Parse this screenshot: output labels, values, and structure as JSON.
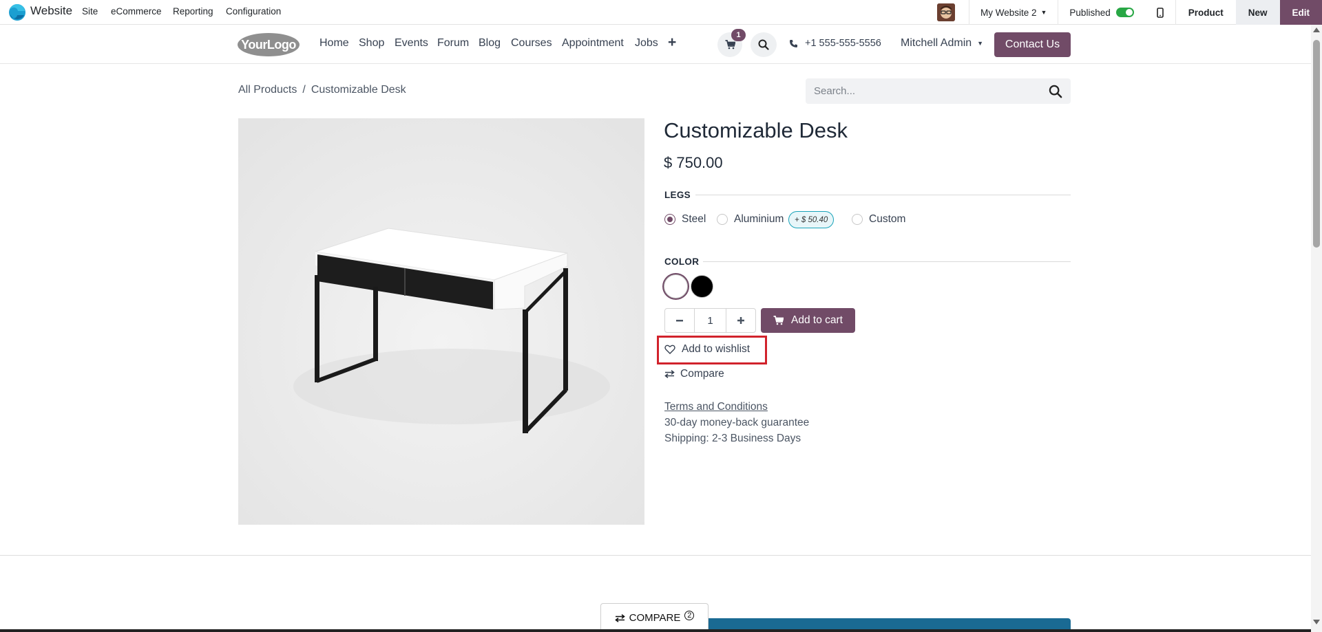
{
  "admin_bar": {
    "app_name": "Website",
    "menus": [
      "Site",
      "eCommerce",
      "Reporting",
      "Configuration"
    ],
    "website_switcher": "My Website 2",
    "published_label": "Published",
    "published": true,
    "product_label": "Product",
    "new_label": "New",
    "edit_label": "Edit"
  },
  "site_header": {
    "logo_text": "YourLogo",
    "nav": [
      "Home",
      "Shop",
      "Events",
      "Forum",
      "Blog",
      "Courses",
      "Appointment",
      "Jobs"
    ],
    "plus_icon": "+",
    "cart_count": "1",
    "phone": "+1 555-555-5556",
    "user": "Mitchell Admin",
    "contact_button": "Contact Us"
  },
  "breadcrumb": {
    "parent": "All Products",
    "separator": "/",
    "current": "Customizable Desk"
  },
  "search": {
    "placeholder": "Search..."
  },
  "product": {
    "title": "Customizable Desk",
    "price": "$ 750.00",
    "legs_label": "LEGS",
    "legs_options": [
      {
        "label": "Steel",
        "checked": true
      },
      {
        "label": "Aluminium",
        "checked": false,
        "extra": "+ $ 50.40"
      },
      {
        "label": "Custom",
        "checked": false
      }
    ],
    "color_label": "COLOR",
    "colors": [
      {
        "name": "White",
        "hex": "#ffffff",
        "selected": true
      },
      {
        "name": "Black",
        "hex": "#000000",
        "selected": false
      }
    ],
    "quantity": "1",
    "add_to_cart": "Add to cart",
    "add_to_wishlist": "Add to wishlist",
    "compare": "Compare",
    "terms": "Terms and Conditions",
    "guarantee": "30-day money-back guarantee",
    "shipping": "Shipping: 2-3 Business Days"
  },
  "compare_bar": {
    "label": "COMPARE",
    "count": "2"
  },
  "colors": {
    "primary": "#714b67",
    "published_toggle": "#28a745",
    "extra_price_border": "#17a2b8",
    "highlight": "#d1222b",
    "bottom_banner": "#1a6a93"
  }
}
